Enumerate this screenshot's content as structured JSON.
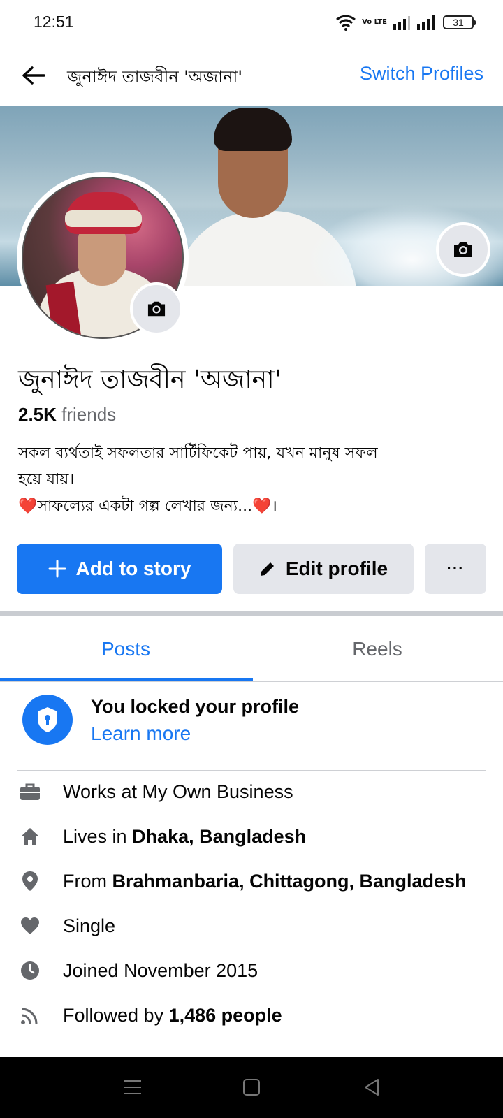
{
  "status_bar": {
    "time": "12:51",
    "volte_label": "Vo LTE",
    "battery": "31"
  },
  "top_bar": {
    "title": "জুনাঈদ তাজবীন 'অজানা'",
    "switch_label": "Switch Profiles"
  },
  "profile": {
    "name": "জুনাঈদ তাজবীন 'অজানা'",
    "friends_count": "2.5K",
    "friends_label": " friends",
    "bio_line1": "সকল ব্যর্থতাই সফলতার সার্টিফিকেট পায়, যখন মানুষ সফল",
    "bio_line2": "হয়ে যায়।",
    "bio_line3_emoji_start": "❤️",
    "bio_line3_text": "সাফল্যের একটা গল্প লেখার জন্য...",
    "bio_line3_emoji_end": "❤️",
    "bio_line3_end": "।"
  },
  "actions": {
    "add_story": "Add to story",
    "edit_profile": "Edit profile",
    "more": "···"
  },
  "tabs": {
    "posts": "Posts",
    "reels": "Reels"
  },
  "lock_notice": {
    "title": "You locked your profile",
    "link": "Learn more"
  },
  "details": [
    {
      "icon": "briefcase-icon",
      "prefix": "Works at My Own Business",
      "bold": ""
    },
    {
      "icon": "home-icon",
      "prefix": "Lives in ",
      "bold": "Dhaka, Bangladesh"
    },
    {
      "icon": "location-pin-icon",
      "prefix": "From ",
      "bold": "Brahmanbaria, Chittagong, Bangladesh"
    },
    {
      "icon": "heart-icon",
      "prefix": "Single",
      "bold": ""
    },
    {
      "icon": "clock-icon",
      "prefix": "Joined November 2015",
      "bold": ""
    },
    {
      "icon": "rss-icon",
      "prefix": "Followed by ",
      "bold": "1,486 people"
    }
  ],
  "colors": {
    "accent": "#1877f2",
    "secondary_text": "#65676b",
    "button_gray": "#e4e6eb"
  }
}
